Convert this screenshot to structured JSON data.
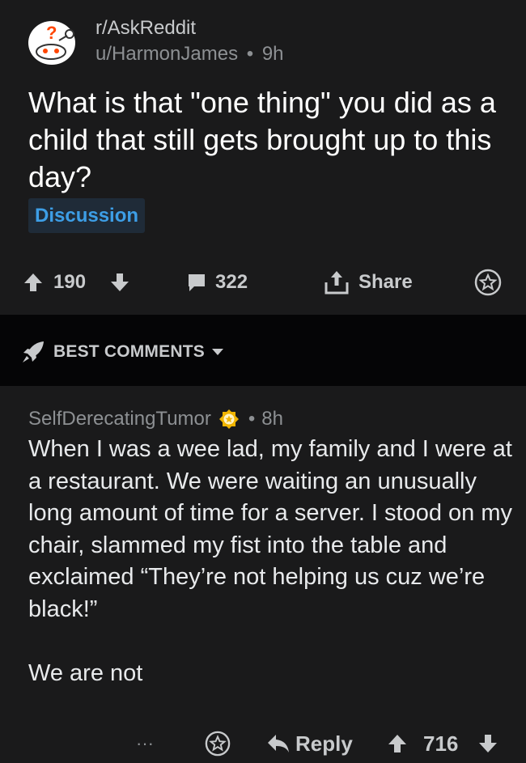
{
  "post": {
    "subreddit": "r/AskReddit",
    "author": "u/HarmonJames",
    "separator": "•",
    "age": "9h",
    "title": "What is that \"one thing\" you did as a child that still gets brought up to this day?",
    "flair": "Discussion",
    "upvotes": "190",
    "comments": "322",
    "share_label": "Share"
  },
  "sort": {
    "label": "BEST COMMENTS"
  },
  "comment": {
    "author": "SelfDerecatingTumor",
    "separator": "•",
    "age": "8h",
    "paragraphs": [
      "When I was a wee lad, my family and I were at a restaurant. We were waiting an unusually long amount of time for a server. I stood on my chair, slammed my fist into the table and exclaimed “They’re not helping us cuz we’re black!”",
      "We are not"
    ],
    "more_label": "···",
    "reply_label": "Reply",
    "score": "716"
  },
  "colors": {
    "background": "#1a1a1b",
    "sortbar": "#050506",
    "flair_text": "#3d9ee6",
    "flair_bg": "#1f2b38",
    "award": "#f0b400"
  },
  "icons": {
    "subreddit_avatar": "askreddit-snoo-icon",
    "upvote": "arrow-up-icon",
    "downvote": "arrow-down-icon",
    "comments": "comment-bubble-icon",
    "share": "share-icon",
    "save": "star-icon",
    "sort": "rocket-icon",
    "sort_dropdown": "caret-down-icon",
    "award": "award-badge-icon",
    "reply": "reply-arrow-icon"
  }
}
